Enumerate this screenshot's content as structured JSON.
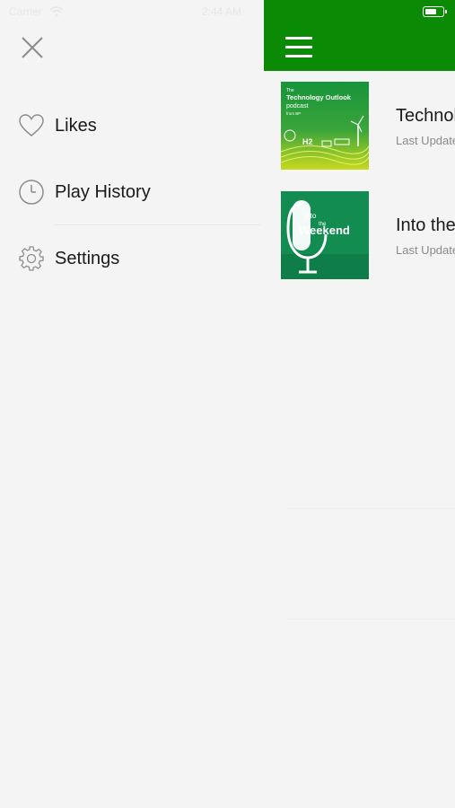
{
  "status_bar": {
    "carrier": "Carrier",
    "time": "2:44 AM",
    "battery_level": 0.7,
    "icons": [
      "wifi-icon",
      "battery-icon"
    ]
  },
  "menu": {
    "close_icon": "close-icon",
    "items": [
      {
        "label": "Likes",
        "icon": "heart-icon"
      },
      {
        "label": "Play History",
        "icon": "clock-icon"
      },
      {
        "label": "Settings",
        "icon": "gear-icon"
      }
    ]
  },
  "main": {
    "menu_icon": "hamburger-icon",
    "accent_color": "#0b8a06",
    "podcasts": [
      {
        "title": "Technology Outlook",
        "subtitle": "Last Updated",
        "cover": {
          "small_text": "The",
          "title": "Technology Outlook",
          "sub": "podcast",
          "from": "from BP",
          "h2_label": "H2",
          "colors": [
            "#1f9a3c",
            "#c8d91f"
          ]
        }
      },
      {
        "title": "Into the Weekend",
        "subtitle": "Last Updated",
        "cover": {
          "line1": "Into",
          "line2": "the",
          "line3": "Weekend",
          "colors": [
            "#17925a",
            "#0e7a45"
          ]
        }
      }
    ]
  }
}
